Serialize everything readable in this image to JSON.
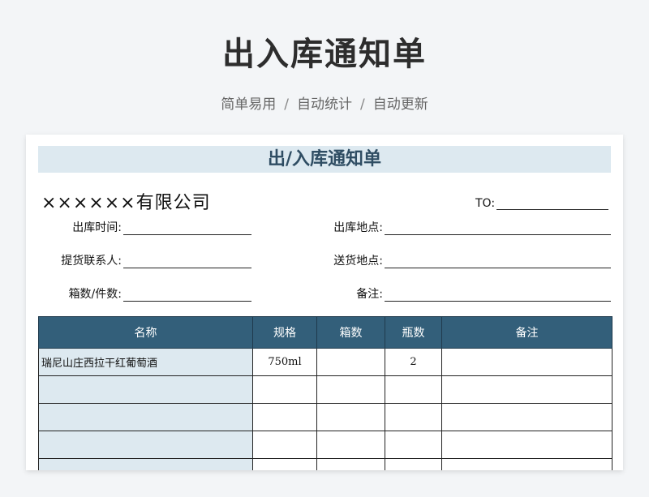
{
  "hero": {
    "title": "出入库通知单",
    "tags": [
      "简单易用",
      "自动统计",
      "自动更新"
    ],
    "separator": "/"
  },
  "sheet": {
    "title": "出/入库通知单",
    "company": "××××××有限公司",
    "to_label": "TO:",
    "fields": {
      "out_time": "出库时间:",
      "out_location": "出库地点:",
      "pickup_contact": "提货联系人:",
      "delivery_location": "送货地点:",
      "box_count": "箱数/件数:",
      "remarks": "备注:"
    },
    "table": {
      "headers": [
        "名称",
        "规格",
        "箱数",
        "瓶数",
        "备注"
      ],
      "rows": [
        [
          "瑞尼山庄西拉干红葡萄酒",
          "750ml",
          "",
          "2",
          ""
        ],
        [
          "",
          "",
          "",
          "",
          ""
        ],
        [
          "",
          "",
          "",
          "",
          ""
        ],
        [
          "",
          "",
          "",
          "",
          ""
        ],
        [
          "",
          "",
          "",
          "",
          ""
        ]
      ]
    }
  },
  "colors": {
    "header_bg": "#335f7a",
    "accent_light": "#dde9f0",
    "title_text": "#2f4d63"
  }
}
